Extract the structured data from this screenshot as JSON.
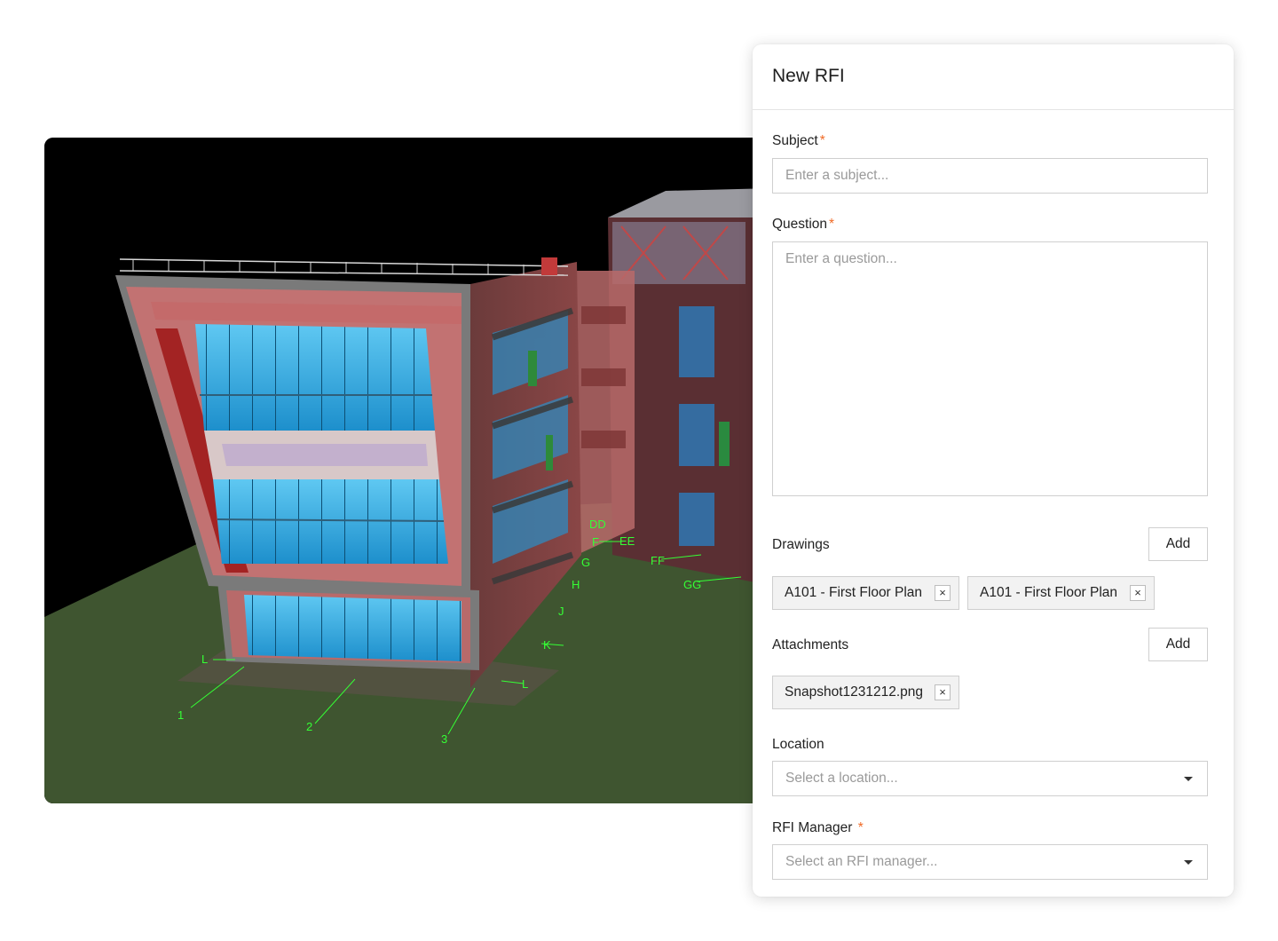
{
  "panel": {
    "title": "New RFI",
    "subject": {
      "label": "Subject",
      "required_mark": "*",
      "placeholder": "Enter a subject..."
    },
    "question": {
      "label": "Question",
      "required_mark": "*",
      "placeholder": "Enter a question..."
    },
    "drawings": {
      "label": "Drawings",
      "add_label": "Add",
      "items": [
        {
          "name": "A101 - First Floor Plan",
          "remove": "×"
        },
        {
          "name": "A101 - First Floor Plan",
          "remove": "×"
        }
      ]
    },
    "attachments": {
      "label": "Attachments",
      "add_label": "Add",
      "items": [
        {
          "name": "Snapshot1231212.png",
          "remove": "×"
        }
      ]
    },
    "location": {
      "label": "Location",
      "placeholder": "Select a location..."
    },
    "rfi_manager": {
      "label": "RFI Manager",
      "required_mark": "*",
      "placeholder": "Select an RFI manager..."
    }
  },
  "viewer": {
    "grid_labels": {
      "l1": "L",
      "l2": "L",
      "g1": "1",
      "g2": "2",
      "g3": "3",
      "dd": "DD",
      "f": "F",
      "g": "G",
      "h": "H",
      "j": "J",
      "k": "K",
      "ee": "EE",
      "ff": "FF",
      "gg": "GG"
    }
  },
  "colors": {
    "accent_required": "#f06a26",
    "ground": "#3f5530",
    "glass": "#2a9fd8",
    "frame": "#b84f4f"
  }
}
